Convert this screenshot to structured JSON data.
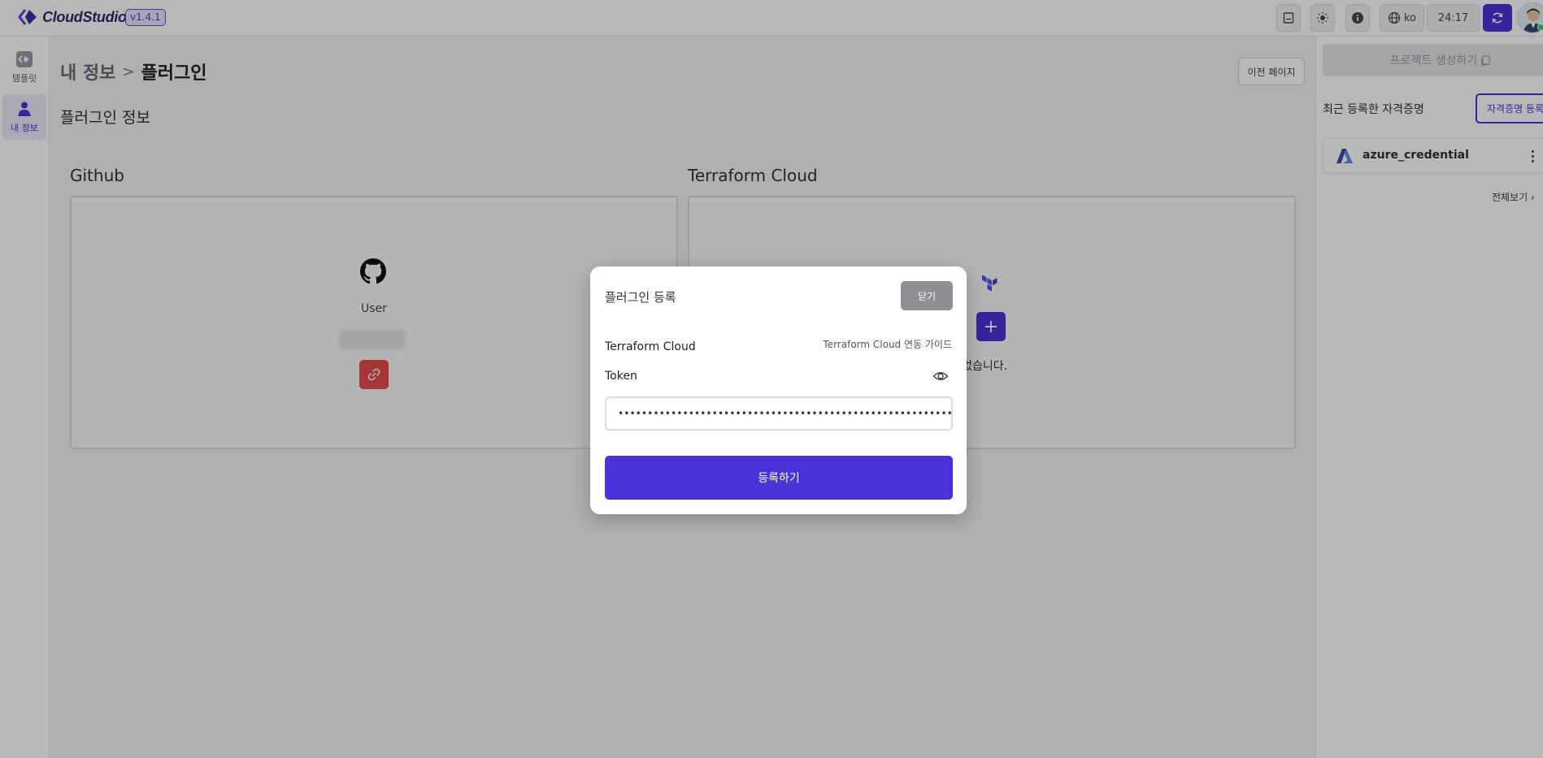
{
  "app": {
    "name": "CloudStudio",
    "version": "v1.4.1"
  },
  "topbar": {
    "language": "ko",
    "timer": "24:17",
    "icons": [
      "book-icon",
      "sun-icon",
      "info-icon",
      "globe-icon",
      "refresh-icon"
    ]
  },
  "leftnav": {
    "items": [
      {
        "label": "템플릿",
        "icon": "template-icon",
        "active": false
      },
      {
        "label": "내 정보",
        "icon": "user-icon",
        "active": true
      }
    ]
  },
  "main": {
    "breadcrumb": {
      "parent": "내 정보",
      "separator": ">",
      "current": "플러그인"
    },
    "prev_page_label": "이전 페이지",
    "section_title": "플러그인 정보",
    "github": {
      "title": "Github",
      "user_label": "User"
    },
    "terraform": {
      "title": "Terraform Cloud",
      "add_label": "+",
      "empty_text": "계정이 없습니다."
    }
  },
  "rightpanel": {
    "create_project_label": "프로젝트 생성하기",
    "recent_title": "최근 등록한 자격증명",
    "register_credential_label": "자격증명 등록",
    "credentials": [
      {
        "name": "azure_credential",
        "icon": "azure-icon"
      }
    ],
    "view_all_label": "전체보기 ›"
  },
  "modal": {
    "title": "플러그인 등록",
    "close_label": "닫기",
    "plugin_name": "Terraform Cloud",
    "guide_link": "Terraform Cloud 연동 가이드",
    "token_label": "Token",
    "token_value": "••••••••••••••••••••••••••••••••••••••••••••••••••••••••••••",
    "submit_label": "등록하기"
  },
  "colors": {
    "accent": "#4a33d6",
    "danger": "#e64b4b",
    "close_button": "#8e8e94"
  }
}
